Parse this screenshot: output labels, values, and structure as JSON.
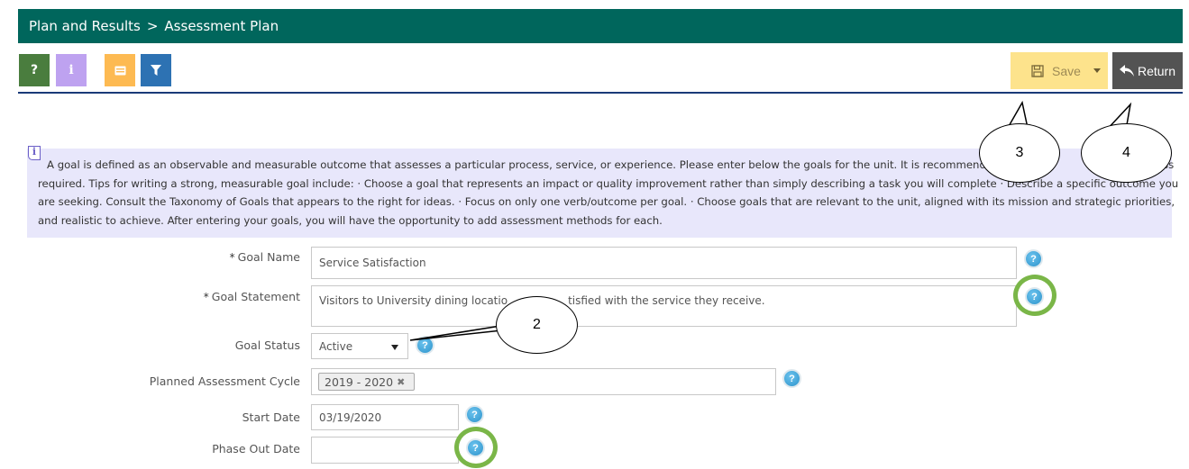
{
  "header": {
    "crumb_root": "Plan and Results",
    "separator": ">",
    "crumb_current": "Assessment Plan"
  },
  "toolbar": {
    "help_label": "?",
    "info_label": "i",
    "colors": {
      "help": "#4a7d3e",
      "info": "#bea2f0",
      "notes": "#fdba52",
      "filter": "#2d72b3"
    }
  },
  "actions": {
    "save_label": "Save",
    "return_label": "Return"
  },
  "instructions": {
    "icon_label": "i",
    "line1": "A goal is defined as an observable and measurable outcome that assesses a particular process, service, or experience. Please enter below the goals for the unit. It is recommended t",
    "line1_tail": "unless",
    "line2": "required. Tips for writing a strong, measurable goal include: · Choose a goal that represents an impact or quality improvement rather than simply describing a task you will complete · Describe a specific outcome you",
    "line3": "are seeking. Consult the Taxonomy of Goals that appears to the right for ideas. · Focus on only one verb/outcome per goal. · Choose goals that are relevant to the unit, aligned with its mission and strategic priorities,",
    "line4": "and realistic to achieve. After entering your goals, you will have the opportunity to add assessment methods for each."
  },
  "form": {
    "required_mark": "*",
    "goal_name": {
      "label": "Goal Name",
      "value": "Service Satisfaction"
    },
    "goal_statement": {
      "label": "Goal Statement",
      "value_a": "Visitors to University dining locatio",
      "value_b": "tisfied with the service they receive."
    },
    "goal_status": {
      "label": "Goal Status",
      "value": "Active"
    },
    "planned_cycle": {
      "label": "Planned Assessment Cycle",
      "tag": "2019 - 2020",
      "remove": "✖"
    },
    "start_date": {
      "label": "Start Date",
      "value": "03/19/2020"
    },
    "phase_out_date": {
      "label": "Phase Out Date",
      "value": ""
    },
    "help_glyph": "?"
  },
  "callouts": {
    "two": "2",
    "three": "3",
    "four": "4"
  },
  "accent_colors": {
    "header": "#00665c",
    "highlight_ring": "#7ab648",
    "save_bg": "#fde38c",
    "return_bg": "#535353",
    "info_bg": "#e8e7fb"
  }
}
